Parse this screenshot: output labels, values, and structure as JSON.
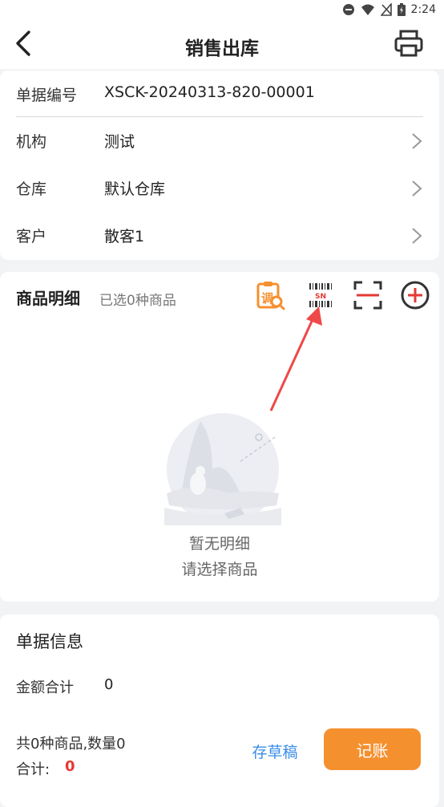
{
  "status_bar": {
    "time": "2:24"
  },
  "header": {
    "title": "销售出库",
    "back_icon": "back-arrow-icon",
    "print_icon": "printer-icon"
  },
  "form": {
    "fields": [
      {
        "label": "单据编号",
        "value": "XSCK-20240313-820-00001"
      },
      {
        "label": "机构",
        "value": "测试"
      },
      {
        "label": "仓库",
        "value": "默认仓库"
      },
      {
        "label": "客户",
        "value": "散客1"
      }
    ]
  },
  "details": {
    "title": "商品明细",
    "subtitle": "已选0种商品",
    "tools": [
      "adjust-search-icon",
      "sn-barcode-icon",
      "scan-icon",
      "add-circle-icon"
    ],
    "adjust_glyph": "调",
    "sn_text": "SN",
    "empty_title": "暂无明细",
    "empty_subtitle": "请选择商品"
  },
  "doc_info": {
    "title": "单据信息",
    "amount_label": "金额合计",
    "amount_value": "0",
    "summary": "共0种商品,数量0",
    "total_label": "合计:",
    "total_value": "0",
    "draft_label": "存草稿",
    "post_label": "记账"
  },
  "colors": {
    "accent": "#f5902f",
    "red": "#e53935",
    "link": "#3a8ee6"
  }
}
